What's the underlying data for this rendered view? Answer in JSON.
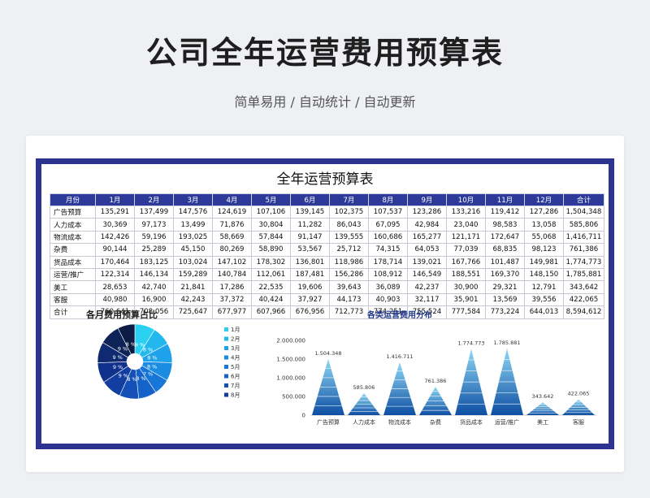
{
  "hero": {
    "title": "公司全年运营费用预算表",
    "subtitle": "简单易用 / 自动统计 / 自动更新"
  },
  "sheet": {
    "title": "全年运营预算表",
    "headers": [
      "月份",
      "1月",
      "2月",
      "3月",
      "4月",
      "5月",
      "6月",
      "7月",
      "8月",
      "9月",
      "10月",
      "11月",
      "12月",
      "合计"
    ],
    "rows": [
      [
        "广告预算",
        "135,291",
        "137,499",
        "147,576",
        "124,619",
        "107,106",
        "139,145",
        "102,375",
        "107,537",
        "123,286",
        "133,216",
        "119,412",
        "127,286",
        "1,504,348"
      ],
      [
        "人力成本",
        "30,369",
        "97,173",
        "13,499",
        "71,876",
        "30,804",
        "11,282",
        "86,043",
        "67,095",
        "42,984",
        "23,040",
        "98,583",
        "13,058",
        "585,806"
      ],
      [
        "物流成本",
        "142,426",
        "59,196",
        "193,025",
        "58,669",
        "57,844",
        "91,147",
        "139,555",
        "160,686",
        "165,277",
        "121,171",
        "172,647",
        "55,068",
        "1,416,711"
      ],
      [
        "杂费",
        "90,144",
        "25,289",
        "45,150",
        "80,269",
        "58,890",
        "53,567",
        "25,712",
        "74,315",
        "64,053",
        "77,039",
        "68,835",
        "98,123",
        "761,386"
      ],
      [
        "货品成本",
        "170,464",
        "183,125",
        "103,024",
        "147,102",
        "178,302",
        "136,801",
        "118,986",
        "178,714",
        "139,021",
        "167,766",
        "101,487",
        "149,981",
        "1,774,773"
      ],
      [
        "运营/推广",
        "122,314",
        "146,134",
        "159,289",
        "140,784",
        "112,061",
        "187,481",
        "156,286",
        "108,912",
        "146,549",
        "188,551",
        "169,370",
        "148,150",
        "1,785,881"
      ],
      [
        "美工",
        "28,653",
        "42,740",
        "21,841",
        "17,286",
        "22,535",
        "19,606",
        "39,643",
        "36,089",
        "42,237",
        "30,900",
        "29,321",
        "12,791",
        "343,642"
      ],
      [
        "客服",
        "40,980",
        "16,900",
        "42,243",
        "37,372",
        "40,424",
        "37,927",
        "44,173",
        "40,903",
        "32,117",
        "35,901",
        "13,569",
        "39,556",
        "422,065"
      ],
      [
        "合计",
        "760,641",
        "708,056",
        "725,647",
        "677,977",
        "607,966",
        "676,956",
        "712,773",
        "774,251",
        "755,524",
        "777,584",
        "773,224",
        "644,013",
        "8,594,612"
      ]
    ]
  },
  "chart_data": [
    {
      "type": "pie",
      "title": "各月费用预算占比",
      "categories": [
        "1月",
        "2月",
        "3月",
        "4月",
        "5月",
        "6月",
        "7月",
        "8月",
        "9月",
        "10月",
        "11月",
        "12月"
      ],
      "values": [
        760641,
        708056,
        725647,
        677977,
        607966,
        676956,
        712773,
        774251,
        755524,
        777584,
        773224,
        644013
      ],
      "slice_labels": [
        "9 %",
        "8 %",
        "8 %",
        "8 %",
        "7 %",
        "8 %",
        "8 %",
        "9 %",
        "9 %",
        "9 %",
        "9 %",
        "8 %"
      ],
      "legend_visible": [
        "1月",
        "2月",
        "3月",
        "4月",
        "5月",
        "6月",
        "7月",
        "8月"
      ],
      "legend_placement": "right",
      "colors": [
        "#2ad0f0",
        "#22b8ee",
        "#1ea2ea",
        "#1a8ce2",
        "#1776d8",
        "#1562c8",
        "#1450b6",
        "#123ea2",
        "#10318c",
        "#0f2a70",
        "#0e2458",
        "#0c1c44"
      ]
    },
    {
      "type": "bar",
      "title": "各类运营费用分布",
      "categories": [
        "广告预算",
        "人力成本",
        "物流成本",
        "杂费",
        "货品成本",
        "运营/推广",
        "美工",
        "客服"
      ],
      "values": [
        1504348,
        585806,
        1416711,
        761386,
        1774773,
        1785881,
        343642,
        422065
      ],
      "data_labels": [
        "1.504.348",
        "585.806",
        "1.416.711",
        "761.386",
        "1.774.773",
        "1.785.881",
        "343.642",
        "422.065"
      ],
      "y_ticks": [
        0,
        500000,
        1000000,
        1500000,
        2000000
      ],
      "y_tick_labels": [
        "0",
        "500.000",
        "1.000.000",
        "1.500.000",
        "2.000.000"
      ],
      "ylim": [
        0,
        2000000
      ],
      "bar_style": "pyramid",
      "grid": false,
      "colors": {
        "dark": "#0d4ea3",
        "light": "#8fd8f4"
      }
    }
  ]
}
